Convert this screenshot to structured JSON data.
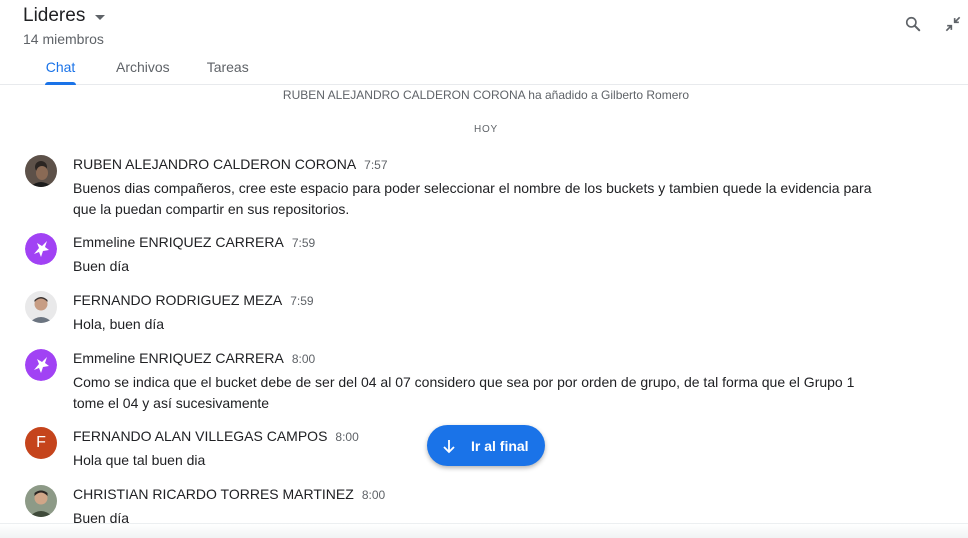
{
  "header": {
    "title": "Lideres",
    "members": "14 miembros",
    "tabs": [
      {
        "label": "Chat"
      },
      {
        "label": "Archivos"
      },
      {
        "label": "Tareas"
      }
    ],
    "accent_color": "#1a73e8"
  },
  "system_message": "RUBEN ALEJANDRO CALDERON CORONA ha añadido a Gilberto Romero",
  "day_separator": "HOY",
  "messages": [
    {
      "author": "RUBEN ALEJANDRO CALDERON CORONA",
      "time": "7:57",
      "text": "Buenos dias compañeros, cree este espacio para poder seleccionar el nombre de los buckets y tambien quede la evidencia para que la puedan compartir en sus repositorios.",
      "avatar": "photo"
    },
    {
      "author": "Emmeline ENRIQUEZ CARRERA",
      "time": "7:59",
      "text": "Buen día",
      "avatar": "unicorn-icon"
    },
    {
      "author": "FERNANDO RODRIGUEZ MEZA",
      "time": "7:59",
      "text": "Hola, buen día",
      "avatar": "photo"
    },
    {
      "author": "Emmeline ENRIQUEZ CARRERA",
      "time": "8:00",
      "text": "Como se indica que el bucket debe de ser del 04 al 07 considero que sea por por orden de grupo, de tal forma que el Grupo 1 tome el 04 y así sucesivamente",
      "avatar": "unicorn-icon"
    },
    {
      "author": "FERNANDO ALAN VILLEGAS CAMPOS",
      "time": "8:00",
      "text": "Hola que tal buen dia",
      "avatar": "F"
    },
    {
      "author": "CHRISTIAN RICARDO TORRES MARTINEZ",
      "time": "8:00",
      "text": "Buen día",
      "avatar": "photo"
    }
  ],
  "jump_button": {
    "label": "Ir al final",
    "icon": "arrow-down-icon"
  }
}
